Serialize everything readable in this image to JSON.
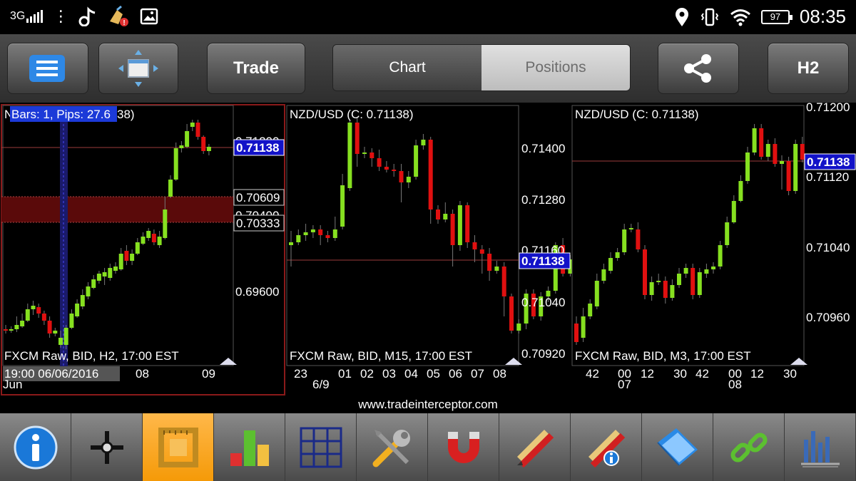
{
  "status_bar": {
    "network": "3G",
    "battery": "97",
    "time": "08:35"
  },
  "toolbar": {
    "trade_label": "Trade",
    "tabs": [
      {
        "label": "Chart",
        "active": true
      },
      {
        "label": "Positions",
        "active": false
      }
    ],
    "timeframe_label": "H2"
  },
  "charts": [
    {
      "title": "Bars: 1, Pips: 27.6",
      "title_hidden": "N",
      "title_tail": "38)",
      "footer": "FXCM Raw, BID, H2, 17:00 EST",
      "price_labels": [
        "0.71200",
        "0.70400",
        "0.69600"
      ],
      "current_price": "0.71138",
      "range_high": "0.70609",
      "range_low": "0.70333",
      "x_labels": [
        "08",
        "09"
      ],
      "cursor_time": "19:00 06/06/2016",
      "month_label": "Jun"
    },
    {
      "title": "NZD/USD (C: 0.71138)",
      "footer": "FXCM Raw, BID, M15, 17:00 EST",
      "price_labels": [
        "0.71400",
        "0.71280",
        "0.71160",
        "0.71040",
        "0.70920"
      ],
      "current_price": "0.71138",
      "x_labels": [
        "23",
        "01",
        "02",
        "03",
        "04",
        "05",
        "06",
        "07",
        "08"
      ],
      "date_label": "6/9"
    },
    {
      "title": "NZD/USD (C: 0.71138)",
      "footer": "FXCM Raw, BID, M3, 17:00 EST",
      "price_labels": [
        "0.71200",
        "0.71120",
        "0.71040",
        "0.70960"
      ],
      "current_price": "0.71138",
      "x_labels": [
        "42",
        "00",
        "12",
        "30",
        "42",
        "00",
        "12",
        "30"
      ],
      "sub_labels": [
        "07",
        "08"
      ]
    }
  ],
  "website": "www.tradeinterceptor.com",
  "bottom_tools": [
    {
      "name": "info-icon",
      "active": false
    },
    {
      "name": "crosshair-icon",
      "active": false
    },
    {
      "name": "ruler-frame-icon",
      "active": true
    },
    {
      "name": "bar-indicator-icon",
      "active": false
    },
    {
      "name": "grid-layout-icon",
      "active": false
    },
    {
      "name": "tools-icon",
      "active": false
    },
    {
      "name": "magnet-icon",
      "active": false
    },
    {
      "name": "drawing-pencil-icon",
      "active": false
    },
    {
      "name": "drawing-info-icon",
      "active": false
    },
    {
      "name": "folder-icon",
      "active": false
    },
    {
      "name": "link-icon",
      "active": false
    },
    {
      "name": "multi-chart-icon",
      "active": false
    }
  ]
}
